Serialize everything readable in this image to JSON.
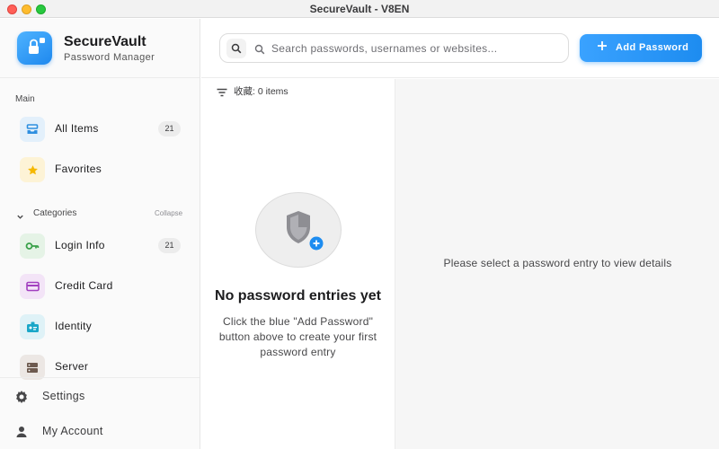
{
  "window": {
    "title": "SecureVault - V8EN"
  },
  "brand": {
    "name": "SecureVault",
    "subtitle": "Password Manager"
  },
  "sidebar": {
    "main_label": "Main",
    "main_items": [
      {
        "label": "All Items",
        "count": "21",
        "icon": "inbox-tray-icon"
      },
      {
        "label": "Favorites",
        "count": "",
        "icon": "star-icon"
      }
    ],
    "categories_label": "Categories",
    "collapse_label": "Collapse",
    "categories": [
      {
        "label": "Login Info",
        "count": "21",
        "icon": "key-icon"
      },
      {
        "label": "Credit Card",
        "count": "",
        "icon": "credit-card-icon"
      },
      {
        "label": "Identity",
        "count": "",
        "icon": "id-badge-icon"
      },
      {
        "label": "Server",
        "count": "",
        "icon": "server-icon"
      }
    ],
    "footer": [
      {
        "label": "Settings",
        "icon": "gear-icon"
      },
      {
        "label": "My Account",
        "icon": "user-icon"
      }
    ]
  },
  "search": {
    "placeholder": "Search passwords, usernames or websites...",
    "value": ""
  },
  "toolbar": {
    "add_label": "Add Password"
  },
  "list": {
    "filter_text": "收藏: 0 items",
    "empty_title": "No password entries yet",
    "empty_description": "Click the blue \"Add Password\" button above to create your first password entry"
  },
  "detail": {
    "placeholder": "Please select a password entry to view details"
  },
  "colors": {
    "accent": "#1d8cf0",
    "all_items": "#2f8fe0",
    "favorites": "#f5b800",
    "login": "#3aa14a",
    "credit_card": "#a23fbf",
    "identity": "#1aa7c8",
    "server": "#6d5a4f"
  }
}
